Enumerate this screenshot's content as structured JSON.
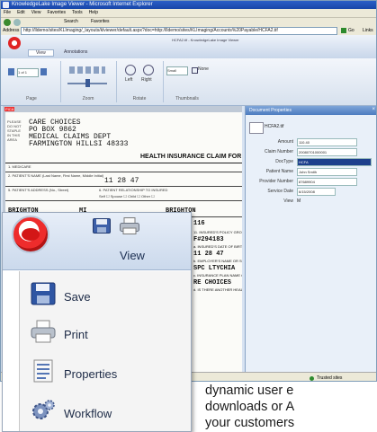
{
  "browser": {
    "title": "KnowledgeLake Image Viewer - Microsoft Internet Explorer",
    "menu": [
      "File",
      "Edit",
      "View",
      "Favorites",
      "Tools",
      "Help"
    ],
    "nav": [
      "Back",
      "Search",
      "Favorites"
    ],
    "address_label": "Address",
    "address_url": "http://lldemo/sites/KLImaging/_layouts/klviewer/default.aspx?doc=http://lldemo/sites/KLImaging/Accounts%20Payable/HCFA2.tif",
    "go_label": "Go",
    "links_label": "Links",
    "status_text": "Trusted sites"
  },
  "app": {
    "doc_title": "HCFA2.tif - KnowledgeLake Image Viewer",
    "tabs": [
      "View",
      "Annotations"
    ],
    "page_field": "1 of 1",
    "zoom_value": "Small",
    "none_label": "None",
    "left_label": "Left",
    "right_label": "Right",
    "groups": [
      "Page",
      "Zoom",
      "Rotate",
      "Thumbnails"
    ]
  },
  "document": {
    "stamp": [
      "PLEASE",
      "DO NOT",
      "STAPLE",
      "IN THIS",
      "AREA"
    ],
    "address": [
      "CARE CHOICES",
      "PO BOX 9862",
      "MEDICAL CLAIMS DEPT",
      "FARMINGTON HILLSI 48333"
    ],
    "form_title": "HEALTH INSURANCE CLAIM FOR",
    "pica": "PICA",
    "field_1": "1. MEDICARE",
    "field_2": "2. PATIENT'S NAME (Last Name, First Name, Middle Initial)",
    "birth_date": "11 28 47",
    "field_5": "5. PATIENT'S ADDRESS (No., Street)",
    "relationship": "6. PATIENT RELATIONSHIP TO INSURED",
    "status_labels": [
      "Self",
      "Spouse",
      "Child",
      "Other"
    ],
    "city_1": "BRIGHTON",
    "state_1": "MI",
    "city_2": "BRIGHTON",
    "side_refs": [
      "11. INSURED'S POLICY GROUP OR FECA NUMBER",
      "F#294183",
      "a. INSURED'S DATE OF BIRTH",
      "11 28 47",
      "b. EMPLOYER'S NAME OR SCHOOL NAME",
      "SPC LTYCHIA",
      "c. INSURANCE PLAN NAME OR PROGRAM NAME",
      "RE CHOICES",
      "d. IS THERE ANOTHER HEALTH BENEFIT PLAN?"
    ],
    "zip_ref": "116"
  },
  "properties": {
    "title": "Document Properties",
    "doc_button": "HCFA2.tif",
    "rows": [
      {
        "label": "Amount",
        "value": "110.40"
      },
      {
        "label": "Claim Number",
        "value": "20080701000001"
      },
      {
        "label": "DocType",
        "value": "HCFA"
      },
      {
        "label": "Patient Name",
        "value": "John Smith"
      },
      {
        "label": "Provider Number",
        "value": "87689904"
      },
      {
        "label": "Service Date",
        "value": "6/15/2008"
      },
      {
        "label": "View",
        "value": "M"
      }
    ]
  },
  "zoom_panel": {
    "view_label": "View",
    "menu": [
      {
        "label": "Save",
        "icon": "floppy-disk-icon"
      },
      {
        "label": "Print",
        "icon": "printer-icon"
      },
      {
        "label": "Properties",
        "icon": "properties-icon"
      },
      {
        "label": "Workflow",
        "icon": "gear-workflow-icon"
      }
    ]
  },
  "caption": {
    "lines": [
      "dynamic user e",
      "downloads or A",
      "your customers"
    ]
  }
}
